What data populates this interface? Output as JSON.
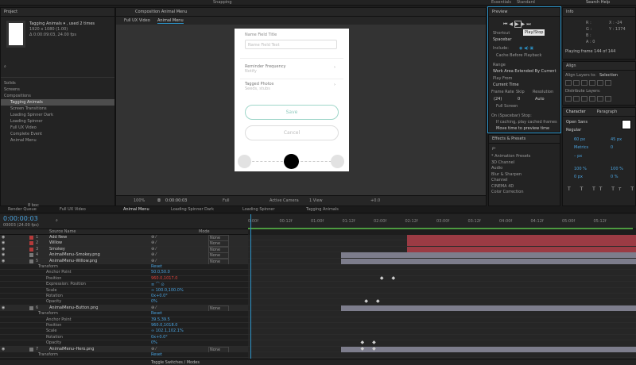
{
  "top": {
    "workspaces": [
      "Essentials",
      "Standard"
    ],
    "snapping": "Snapping",
    "search": "Search Help"
  },
  "project": {
    "title": "Project",
    "thumb_name": "Tagging Animals ▾ , used 2 times",
    "thumb_info": "1920 x 1080 (1.00)",
    "thumb_dur": "Δ 0:00:09:03, 24.00 fps",
    "items": [
      {
        "label": "Solids"
      },
      {
        "label": "Screens"
      },
      {
        "label": "Compositions"
      },
      {
        "label": "Tagging Animals",
        "hl": true
      },
      {
        "label": "Screen Transitions"
      },
      {
        "label": "Loading Spinner Dark"
      },
      {
        "label": "Loading Spinner"
      },
      {
        "label": "Full UX Video"
      },
      {
        "label": "Complete Event"
      },
      {
        "label": "Animal Menu"
      }
    ],
    "bpc": "8 bpc"
  },
  "comp": {
    "title": "Composition Animal Menu",
    "tabs": [
      "Full UX Video",
      "Animal Menu"
    ],
    "phone": {
      "field_label": "Name Field Title",
      "field_placeholder": "Name Field Text",
      "reminder_label": "Reminder Frequency",
      "reminder_sub": "Notify",
      "tagged_label": "Tagged Photos",
      "tagged_sub": "Seeds, stubs",
      "save": "Save",
      "cancel": "Cancel"
    },
    "footer": {
      "zoom": "100%",
      "time": "0:00:00:03",
      "quality": "Full",
      "camera": "Active Camera",
      "view": "1 View",
      "offset": "+0.0"
    }
  },
  "preview": {
    "title": "Preview",
    "tooltip": "Play/Stop",
    "shortcut_label": "Shortcut",
    "shortcut_value": "Spacebar",
    "include_label": "Include:",
    "cache": "Cache Before Playback",
    "range_label": "Range",
    "range_value": "Work Area Extended By Current",
    "playfrom_label": "Play From",
    "playfrom_value": "Current Time",
    "framerate_label": "Frame Rate",
    "skip_label": "Skip",
    "resolution_label": "Resolution",
    "framerate_value": "(24)",
    "skip_value": "0",
    "resolution_value": "Auto",
    "fullscreen": "Full Screen",
    "stop_label": "On (Spacebar) Stop:",
    "stop_opt1": "If caching, play cached frames",
    "stop_opt2": "Move time to preview time"
  },
  "info": {
    "title": "Info",
    "r": "R :",
    "g": "G :",
    "b": "B :",
    "a": "A : 0",
    "x": "X : -24",
    "y": "Y : 1374",
    "status": "Playing frame 144 of 144"
  },
  "align": {
    "title": "Align",
    "align_to_label": "Align Layers to:",
    "align_to_value": "Selection",
    "distribute": "Distribute Layers:"
  },
  "character": {
    "tabs": [
      "Character",
      "Paragraph"
    ],
    "font": "Open Sans",
    "style": "Regular",
    "size": "60 px",
    "leading": "45 px",
    "kerning": "Metrics",
    "tracking": "0",
    "stroke": "– px",
    "scale_v": "100 %",
    "scale_h": "100 %",
    "baseline": "0 px",
    "tsume": "0 %"
  },
  "effects": {
    "title": "Effects & Presets",
    "search_placeholder": "ρ-",
    "items": [
      "* Animation Presets",
      "3D Channel",
      "Audio",
      "Blur & Sharpen",
      "Channel",
      "CINEMA 4D",
      "Color Correction"
    ]
  },
  "tabs_bottom": [
    {
      "label": "Render Queue"
    },
    {
      "label": "Full UX Video"
    },
    {
      "label": "Animal Menu",
      "active": true
    },
    {
      "label": "Loading Spinner Dark"
    },
    {
      "label": "Loading Spinner"
    },
    {
      "label": "Tagging Animals"
    }
  ],
  "timeline": {
    "timecode": "0:00:00:03",
    "frames": "00003 (24.00 fps)",
    "source_label": "Source Name",
    "mode_label": "Mode",
    "parent_label": "Parent",
    "footer": "Toggle Switches / Modes",
    "ruler": [
      "0:00f",
      "00:12f",
      "01:00f",
      "01:12f",
      "02:00f",
      "02:12f",
      "03:00f",
      "03:12f",
      "04:00f",
      "04:12f",
      "05:00f",
      "05:12f"
    ],
    "layers": [
      {
        "num": "1",
        "name": "Add New",
        "kind": "layer",
        "color": "#b53a3a",
        "parent": "None",
        "bar_start": 0.41,
        "bar_color": "#9b3b44"
      },
      {
        "num": "2",
        "name": "Willow",
        "kind": "layer",
        "color": "#b53a3a",
        "parent": "None",
        "bar_start": 0.41,
        "bar_color": "#9b3b44"
      },
      {
        "num": "3",
        "name": "Smokey",
        "kind": "layer",
        "color": "#b53a3a",
        "parent": "None",
        "bar_start": 0.41,
        "bar_color": "#9b3b44"
      },
      {
        "num": "4",
        "name": "AnimalMenu–Smokey.png",
        "kind": "layer",
        "color": "#777",
        "parent": "None",
        "bar_start": 0.24,
        "bar_color": "#7d7d8c"
      },
      {
        "num": "5",
        "name": "AnimalMenu–Willow.png",
        "kind": "layer",
        "color": "#777",
        "parent": "None",
        "bar_start": 0.24,
        "bar_color": "#7d7d8c"
      },
      {
        "name": "Transform",
        "kind": "group",
        "val": "Reset"
      },
      {
        "name": "Anchor Point",
        "kind": "prop",
        "val": "50.0,50.0"
      },
      {
        "name": "Position",
        "kind": "prop",
        "val": "960.0,1017.0",
        "red": true,
        "keys": [
          0.34,
          0.37
        ]
      },
      {
        "name": "Expression: Position",
        "kind": "prop",
        "val": "≡ ⌒ ⊙"
      },
      {
        "name": "Scale",
        "kind": "prop",
        "val": "∞ 100.0,100.0%"
      },
      {
        "name": "Rotation",
        "kind": "prop",
        "val": "0x+0.0°"
      },
      {
        "name": "Opacity",
        "kind": "prop",
        "val": "0%",
        "keys": [
          0.3,
          0.33
        ]
      },
      {
        "num": "6",
        "name": "AnimalMenu–Button.png",
        "kind": "layer",
        "color": "#777",
        "parent": "None",
        "bar_start": 0.24,
        "bar_color": "#7d7d8c"
      },
      {
        "name": "Transform",
        "kind": "group",
        "val": "Reset"
      },
      {
        "name": "Anchor Point",
        "kind": "prop",
        "val": "39.5,39.5"
      },
      {
        "name": "Position",
        "kind": "prop",
        "val": "960.0,1018.0"
      },
      {
        "name": "Scale",
        "kind": "prop",
        "val": "∞ 102.1,102.1%"
      },
      {
        "name": "Rotation",
        "kind": "prop",
        "val": "0x+0.0°"
      },
      {
        "name": "Opacity",
        "kind": "prop",
        "val": "0%",
        "keys": [
          0.29,
          0.32
        ]
      },
      {
        "num": "7",
        "name": "AnimalMenu–Hero.png",
        "kind": "layer",
        "color": "#777",
        "parent": "None",
        "bar_start": 0.24,
        "bar_color": "#7d7d8c",
        "keys": [
          0.29,
          0.32
        ]
      },
      {
        "name": "Transform",
        "kind": "group",
        "val": "Reset"
      }
    ]
  }
}
